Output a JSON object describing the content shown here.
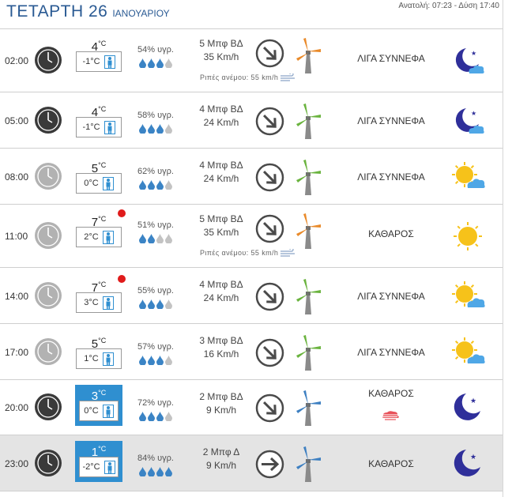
{
  "header": {
    "day": "ΤΕΤΑΡΤΗ 26",
    "month": "ΙΑΝΟΥΑΡΙΟΥ",
    "sun_times": "Ανατολή: 07:23  - Δύση 17:40"
  },
  "colors": {
    "accent": "#2f8fd0",
    "title": "#2a5a93",
    "alert": "#e01b1b",
    "drop": "#3b84c5"
  },
  "rows": [
    {
      "time": "02:00",
      "temp": "4",
      "unit": "°C",
      "feels": "-1°C",
      "humidity": "54% υγρ.",
      "drops_full": 3,
      "wind_bf": "5 Μπφ ΒΔ",
      "wind_kmh": "35 Km/h",
      "gust": "Ριπές ανέμου: 55 km/h",
      "desc": "ΛΙΓΑ ΣΥΝΝΕΦΑ",
      "icon": "moon-cloud-icon",
      "clock": "night-clock-icon",
      "arrow": "arrow-southeast-icon",
      "turbine": "orange-turbine-icon",
      "alert": false,
      "highlight": false
    },
    {
      "time": "05:00",
      "temp": "4",
      "unit": "°C",
      "feels": "-1°C",
      "humidity": "58% υγρ.",
      "drops_full": 3,
      "wind_bf": "4 Μπφ ΒΔ",
      "wind_kmh": "24 Km/h",
      "gust": "",
      "desc": "ΛΙΓΑ ΣΥΝΝΕΦΑ",
      "icon": "moon-cloud-icon",
      "clock": "night-clock-icon",
      "arrow": "arrow-southeast-icon",
      "turbine": "green-turbine-icon",
      "alert": false,
      "highlight": false
    },
    {
      "time": "08:00",
      "temp": "5",
      "unit": "°C",
      "feels": "0°C",
      "humidity": "62% υγρ.",
      "drops_full": 3,
      "wind_bf": "4 Μπφ ΒΔ",
      "wind_kmh": "24 Km/h",
      "gust": "",
      "desc": "ΛΙΓΑ ΣΥΝΝΕΦΑ",
      "icon": "sun-cloud-icon",
      "clock": "day-clock-icon",
      "arrow": "arrow-southeast-icon",
      "turbine": "green-turbine-icon",
      "alert": false,
      "highlight": false
    },
    {
      "time": "11:00",
      "temp": "7",
      "unit": "°C",
      "feels": "2°C",
      "humidity": "51% υγρ.",
      "drops_full": 2,
      "wind_bf": "5 Μπφ ΒΔ",
      "wind_kmh": "35 Km/h",
      "gust": "Ριπές ανέμου: 55 km/h",
      "desc": "ΚΑΘΑΡΟΣ",
      "icon": "sun-icon",
      "clock": "day-clock-icon",
      "arrow": "arrow-southeast-icon",
      "turbine": "orange-turbine-icon",
      "alert": true,
      "highlight": false
    },
    {
      "time": "14:00",
      "temp": "7",
      "unit": "°C",
      "feels": "3°C",
      "humidity": "55% υγρ.",
      "drops_full": 3,
      "wind_bf": "4 Μπφ ΒΔ",
      "wind_kmh": "24 Km/h",
      "gust": "",
      "desc": "ΛΙΓΑ ΣΥΝΝΕΦΑ",
      "icon": "sun-cloud-icon",
      "clock": "day-clock-icon",
      "arrow": "arrow-southeast-icon",
      "turbine": "green-turbine-icon",
      "alert": true,
      "highlight": false
    },
    {
      "time": "17:00",
      "temp": "5",
      "unit": "°C",
      "feels": "1°C",
      "humidity": "57% υγρ.",
      "drops_full": 3,
      "wind_bf": "3 Μπφ ΒΔ",
      "wind_kmh": "16 Km/h",
      "gust": "",
      "desc": "ΛΙΓΑ ΣΥΝΝΕΦΑ",
      "icon": "sun-cloud-icon",
      "clock": "day-clock-icon",
      "arrow": "arrow-southeast-icon",
      "turbine": "green-turbine-icon",
      "alert": false,
      "highlight": false
    },
    {
      "time": "20:00",
      "temp": "3",
      "unit": "°C",
      "feels": "0°C",
      "humidity": "72% υγρ.",
      "drops_full": 3,
      "wind_bf": "2 Μπφ ΒΔ",
      "wind_kmh": "9 Km/h",
      "gust": "",
      "desc": "ΚΑΘΑΡΟΣ",
      "icon": "moon-icon",
      "clock": "night-clock-icon",
      "arrow": "arrow-southeast-icon",
      "turbine": "blue-turbine-icon",
      "alert": false,
      "highlight": true,
      "haze": true
    },
    {
      "time": "23:00",
      "temp": "1",
      "unit": "°C",
      "feels": "-2°C",
      "humidity": "84% υγρ.",
      "drops_full": 4,
      "wind_bf": "2 Μπφ Δ",
      "wind_kmh": "9 Km/h",
      "gust": "",
      "desc": "ΚΑΘΑΡΟΣ",
      "icon": "moon-icon",
      "clock": "night-clock-icon",
      "arrow": "arrow-east-icon",
      "turbine": "blue-turbine-icon",
      "alert": false,
      "highlight": true,
      "shaded": true
    }
  ]
}
